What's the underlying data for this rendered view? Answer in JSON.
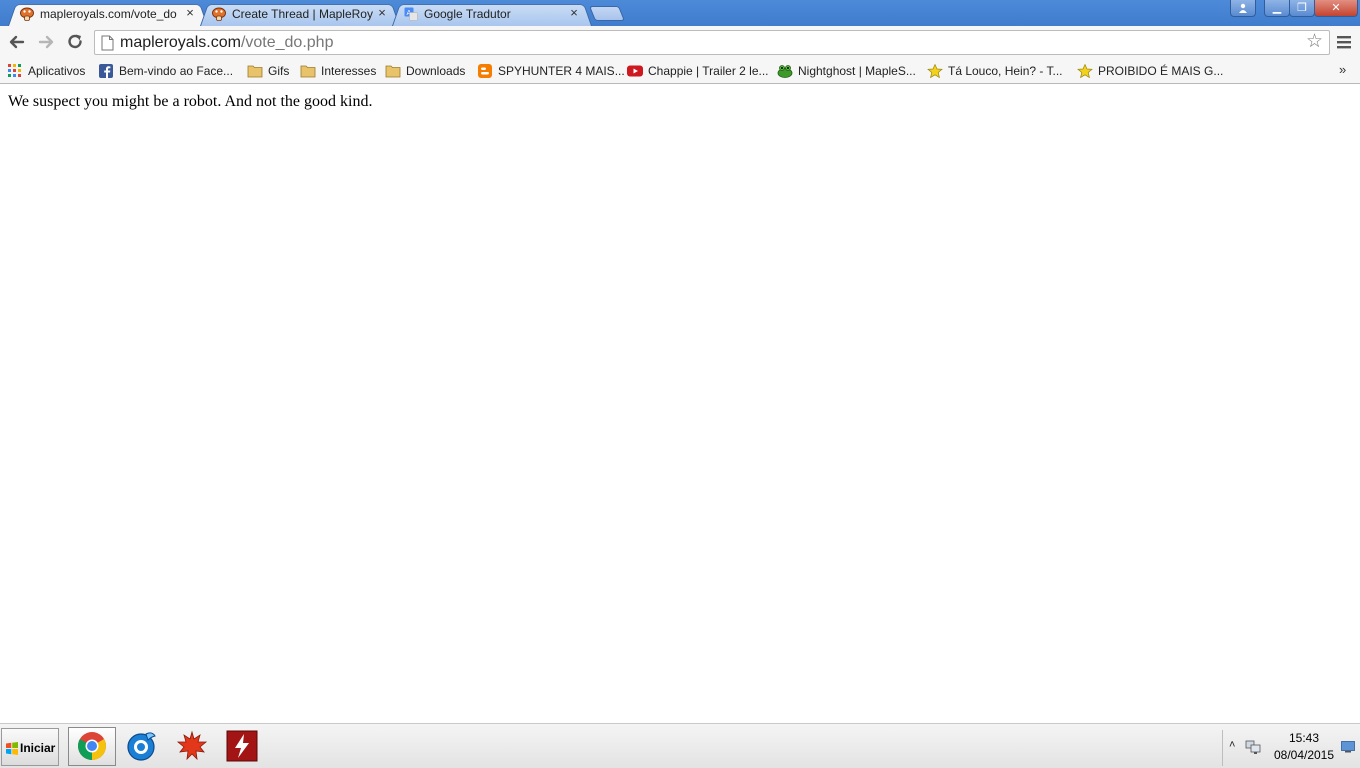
{
  "browser": {
    "tabs": [
      {
        "title": "mapleroyals.com/vote_do",
        "close": "×",
        "active": true,
        "favicon": "mushroom-icon"
      },
      {
        "title": "Create Thread | MapleRoy",
        "close": "×",
        "active": false,
        "favicon": "mushroom-icon"
      },
      {
        "title": "Google Tradutor",
        "close": "×",
        "active": false,
        "favicon": "google-translate-icon"
      }
    ],
    "window_controls": {
      "minimize": "▁",
      "restore": "❐",
      "close": "✕"
    },
    "address": {
      "host": "mapleroyals.com",
      "path": "/vote_do.php"
    },
    "bookmarks": [
      {
        "label": "Aplicativos",
        "icon": "apps-grid-icon"
      },
      {
        "label": "Bem-vindo ao Face...",
        "icon": "facebook-icon"
      },
      {
        "label": "Gifs",
        "icon": "folder-icon"
      },
      {
        "label": "Interesses",
        "icon": "folder-icon"
      },
      {
        "label": "Downloads",
        "icon": "folder-icon"
      },
      {
        "label": "SPYHUNTER 4 MAIS...",
        "icon": "blogger-icon"
      },
      {
        "label": "Chappie | Trailer 2 le...",
        "icon": "youtube-icon"
      },
      {
        "label": "Nightghost | MapleS...",
        "icon": "frog-icon"
      },
      {
        "label": "Tá Louco, Hein? - T...",
        "icon": "star-icon"
      },
      {
        "label": "PROIBIDO É MAIS G...",
        "icon": "star-icon"
      }
    ],
    "bookmarks_overflow": "»"
  },
  "page": {
    "message": "We suspect you might be a robot. And not the good kind."
  },
  "taskbar": {
    "start_label": "Iniciar",
    "tray_chevron": "˄",
    "time": "15:43",
    "date": "08/04/2015"
  },
  "colors": {
    "titlebar": "#4d8ad8",
    "toolbar": "#f6f6f6",
    "facebook": "#3b5998",
    "youtube": "#cc181e",
    "blogger": "#f57d00",
    "folder": "#e8c36a"
  }
}
